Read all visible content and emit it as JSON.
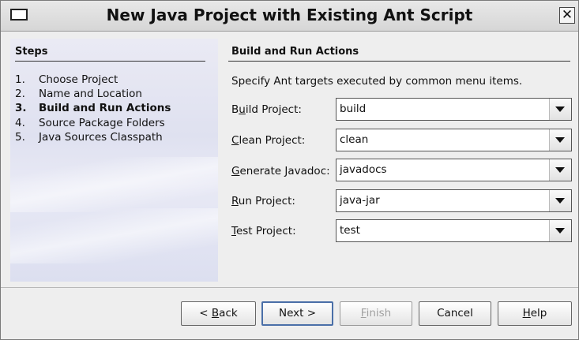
{
  "window": {
    "title": "New Java Project with Existing Ant Script",
    "icon": "window-icon",
    "close_label": "✕"
  },
  "steps": {
    "heading": "Steps",
    "items": [
      {
        "num": "1.",
        "label": "Choose Project",
        "current": false
      },
      {
        "num": "2.",
        "label": "Name and Location",
        "current": false
      },
      {
        "num": "3.",
        "label": "Build and Run Actions",
        "current": true
      },
      {
        "num": "4.",
        "label": "Source Package Folders",
        "current": false
      },
      {
        "num": "5.",
        "label": "Java Sources Classpath",
        "current": false
      }
    ]
  },
  "content": {
    "heading": "Build and Run Actions",
    "description": "Specify Ant targets executed by common menu items.",
    "fields": [
      {
        "label_pre": "B",
        "label_mnemonic": "u",
        "label_post": "ild Project:",
        "value": "build"
      },
      {
        "label_pre": "",
        "label_mnemonic": "C",
        "label_post": "lean Project:",
        "value": "clean"
      },
      {
        "label_pre": "",
        "label_mnemonic": "G",
        "label_post": "enerate Javadoc:",
        "value": "javadocs"
      },
      {
        "label_pre": "",
        "label_mnemonic": "R",
        "label_post": "un Project:",
        "value": "java-jar"
      },
      {
        "label_pre": "",
        "label_mnemonic": "T",
        "label_post": "est Project:",
        "value": "test"
      }
    ]
  },
  "buttons": {
    "back": {
      "pre": "< ",
      "mnemonic": "B",
      "post": "ack"
    },
    "next": {
      "pre": "Next >",
      "mnemonic": "",
      "post": ""
    },
    "finish": {
      "pre": "",
      "mnemonic": "F",
      "post": "inish"
    },
    "cancel": {
      "pre": "Cancel",
      "mnemonic": "",
      "post": ""
    },
    "help": {
      "pre": "",
      "mnemonic": "H",
      "post": "elp"
    }
  }
}
